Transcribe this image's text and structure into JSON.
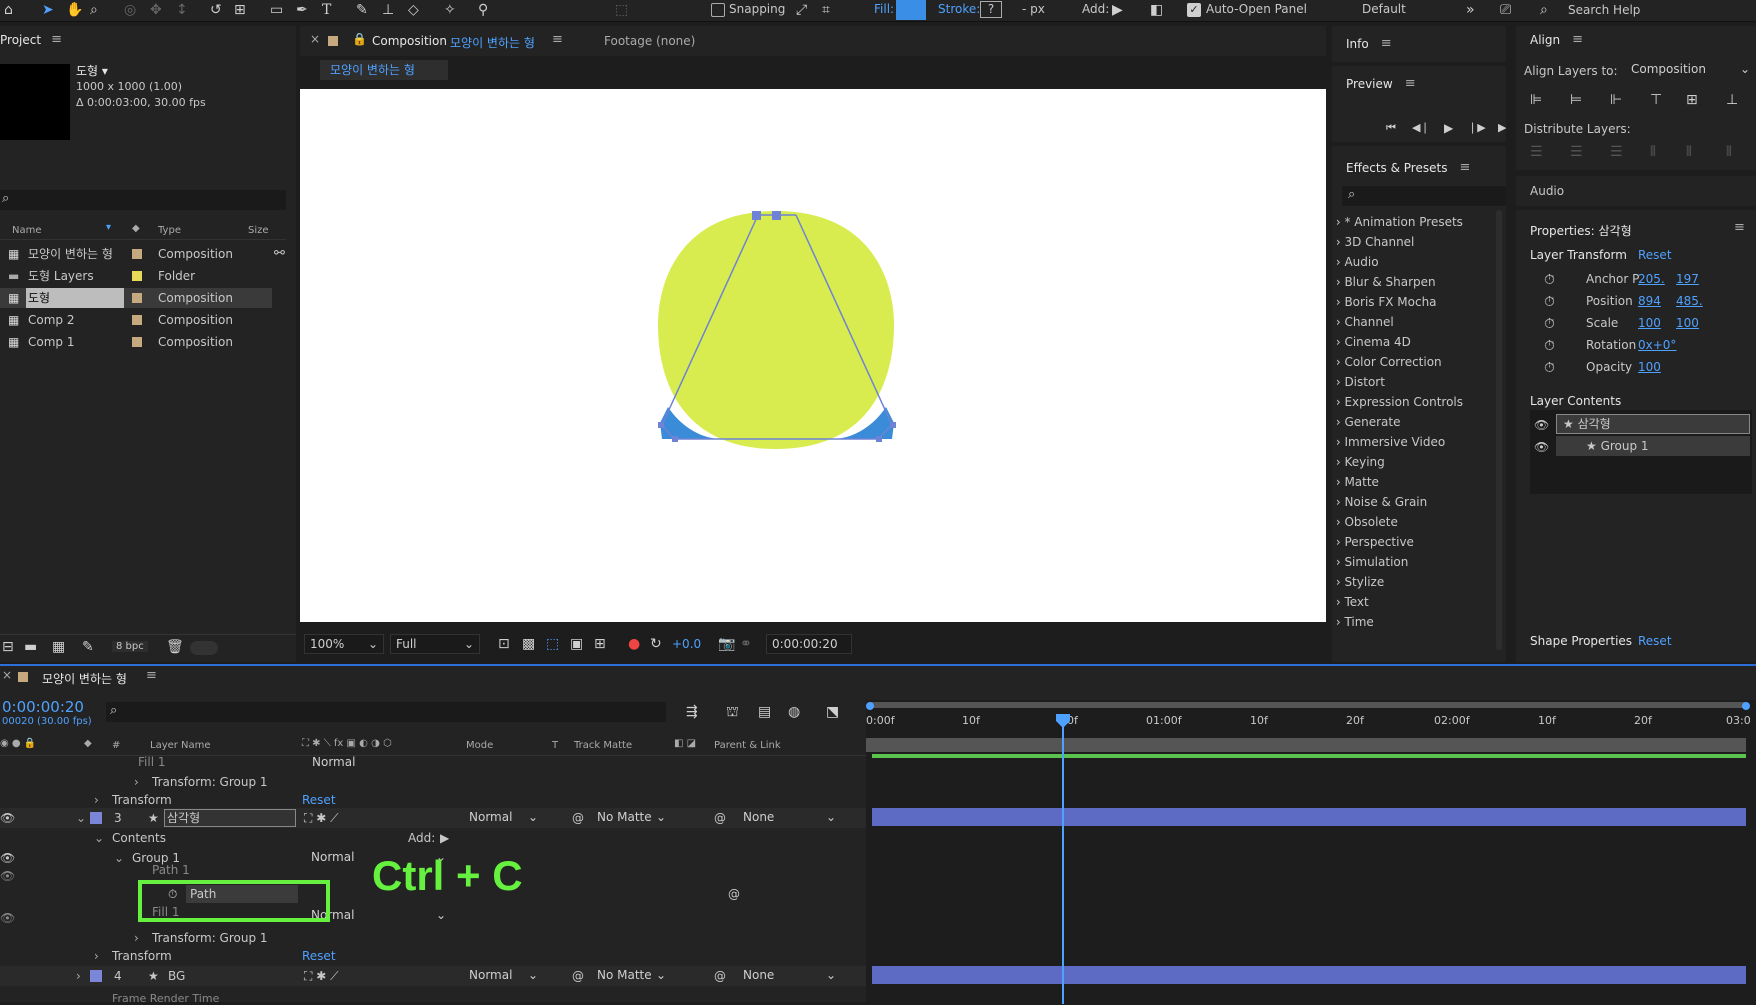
{
  "toolbar": {
    "snapping": "Snapping",
    "fill_label": "Fill:",
    "stroke_label": "Stroke:",
    "stroke_value": "?",
    "stroke_px": "- px",
    "add_label": "Add:",
    "auto_open": "Auto-Open Panel",
    "workspace": "Default",
    "search": "Search Help",
    "fill_color": "#3a8ee6"
  },
  "project": {
    "title": "Project",
    "item_name": "도형 ▾",
    "item_size": "1000 x 1000 (1.00)",
    "item_dur": "Δ 0:00:03:00, 30.00 fps",
    "search_placeholder": "",
    "cols": {
      "name": "Name",
      "type": "Type",
      "size": "Size"
    },
    "items": [
      {
        "name": "모양이 변하는 형",
        "type": "Composition",
        "color": "#c6a97e"
      },
      {
        "name": "도형 Layers",
        "type": "Folder",
        "color": "#e9d95a"
      },
      {
        "name": "도형",
        "type": "Composition",
        "color": "#c6a97e"
      },
      {
        "name": "Comp 2",
        "type": "Composition",
        "color": "#c6a97e"
      },
      {
        "name": "Comp 1",
        "type": "Composition",
        "color": "#c6a97e"
      }
    ],
    "bpc": "8 bpc"
  },
  "comp": {
    "tab_label": "Composition",
    "tab_name": "모양이 변하는 형",
    "footage": "Footage (none)",
    "sub_tab": "모양이 변하는 형",
    "zoom": "100%",
    "quality": "Full",
    "exposure": "+0.0",
    "time": "0:00:00:20"
  },
  "info": {
    "title": "Info"
  },
  "preview": {
    "title": "Preview"
  },
  "effects": {
    "title": "Effects & Presets",
    "items": [
      "* Animation Presets",
      "3D Channel",
      "Audio",
      "Blur & Sharpen",
      "Boris FX Mocha",
      "Channel",
      "Cinema 4D",
      "Color Correction",
      "Distort",
      "Expression Controls",
      "Generate",
      "Immersive Video",
      "Keying",
      "Matte",
      "Noise & Grain",
      "Obsolete",
      "Perspective",
      "Simulation",
      "Stylize",
      "Text",
      "Time"
    ]
  },
  "align": {
    "title": "Align",
    "align_to_label": "Align Layers to:",
    "align_to_value": "Composition",
    "distribute": "Distribute Layers:"
  },
  "audio": {
    "title": "Audio"
  },
  "properties": {
    "title": "Properties: 삼각형",
    "layer_transform": "Layer Transform",
    "reset": "Reset",
    "props": [
      {
        "label": "Anchor P",
        "v1": "205.",
        "v2": "197"
      },
      {
        "label": "Position",
        "v1": "894",
        "v2": "485."
      },
      {
        "label": "Scale",
        "v1": "100",
        "v2": "100"
      },
      {
        "label": "Rotation",
        "v1": "0x+0°",
        "v2": ""
      },
      {
        "label": "Opacity",
        "v1": "100",
        "v2": ""
      }
    ],
    "layer_contents": "Layer Contents",
    "lc_items": [
      "삼각형",
      "Group 1"
    ],
    "shape_props": "Shape Properties",
    "shape_reset": "Reset"
  },
  "timeline": {
    "comp_name": "모양이 변하는 형",
    "timecode": "0:00:00:20",
    "fps": "00020 (30.00 fps)",
    "cols": {
      "layer_name": "Layer Name",
      "mode": "Mode",
      "t": "T",
      "track_matte": "Track Matte",
      "parent": "Parent & Link"
    },
    "ruler": [
      "0:00f",
      "10f",
      "20f",
      "01:00f",
      "10f",
      "20f",
      "02:00f",
      "10f",
      "20f",
      "03:0"
    ],
    "rows": {
      "fill1_top": "Fill 1",
      "fill1_top_mode": "Normal",
      "transform_group1_top": "Transform: Group 1",
      "transform_top": "Transform",
      "reset_top": "Reset",
      "layer3_num": "3",
      "layer3_name": "삼각형",
      "layer3_mode": "Normal",
      "layer3_matte": "No Matte",
      "layer3_parent": "None",
      "contents": "Contents",
      "add": "Add:",
      "group1": "Group 1",
      "group1_mode": "Normal",
      "path1": "Path 1",
      "path": "Path",
      "fill1": "Fill 1",
      "fill1_mode": "Normal",
      "transform_group1": "Transform: Group 1",
      "transform": "Transform",
      "reset": "Reset",
      "layer4_num": "4",
      "layer4_name": "BG",
      "layer4_mode": "Normal",
      "layer4_matte": "No Matte",
      "layer4_parent": "None",
      "frame_render": "Frame Render Time"
    },
    "annotation": "Ctrl + C"
  }
}
